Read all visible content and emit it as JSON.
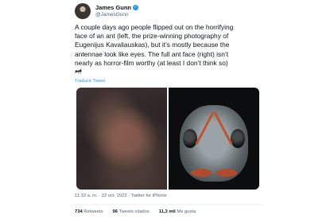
{
  "author": {
    "display_name": "James Gunn",
    "handle": "@JamesGunn",
    "verified_glyph": "✓",
    "verified_color": "#1d9bf0"
  },
  "tweet": {
    "text": "A couple days ago people flipped out on the horrifying\nface of an ant (left, the prize-winning photography of\nEugenijus Kavaliauskas), but it’s mostly because the\nantennae look like eyes. The full ant face (right) isn’t\nnearly as horror-film worthy (at least I don’t think so)",
    "emoji_icon": "ant-emoji",
    "translate_label": "Traducir Tweet"
  },
  "media": {
    "left_photo": "ant-closeup-left",
    "right_photo": "ant-full-face-right"
  },
  "meta": {
    "timestamp": "11:33 a. m. · 22 oct. 2022 · Twitter for iPhone"
  },
  "stats": {
    "retweets_count": "734",
    "retweets_label": "Retweets",
    "quotes_count": "96",
    "quotes_label": "Tweets citados",
    "likes_count": "11,3 mil",
    "likes_label": "Me gusta"
  }
}
